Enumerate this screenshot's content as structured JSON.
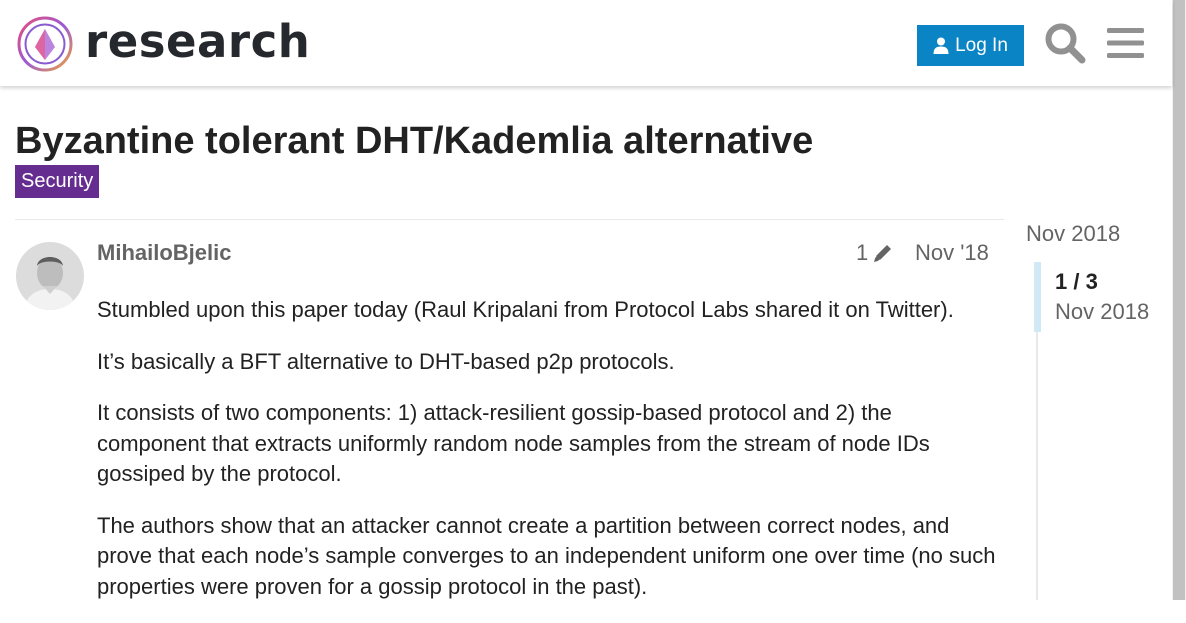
{
  "header": {
    "site_name": "research",
    "login_label": "Log In"
  },
  "topic": {
    "title": "Byzantine tolerant DHT/Kademlia alternative",
    "category": "Security",
    "category_color": "#652d90"
  },
  "post": {
    "username": "MihailoBjelic",
    "edit_count": "1",
    "date": "Nov '18",
    "paragraphs": [
      "Stumbled upon this paper today (Raul Kripalani from Protocol Labs shared it on Twitter).",
      "It’s basically a BFT alternative to DHT-based p2p protocols.",
      "It consists of two components: 1) attack-resilient gossip-based protocol and 2) the component that extracts uniformly random node samples from the stream of node IDs gossiped by the protocol.",
      "The authors show that an attacker cannot create a partition between correct nodes, and prove that each node’s sample converges to an independent uniform one over time (no such properties were proven for a gossip protocol in the past)."
    ]
  },
  "timeline": {
    "start_date": "Nov 2018",
    "position": "1 / 3",
    "current_date": "Nov 2018"
  },
  "icons": {
    "logo": "ethereum-research-logo",
    "login": "user-icon",
    "search": "search-icon",
    "menu": "hamburger-menu-icon",
    "edit": "pencil-icon"
  },
  "colors": {
    "accent": "#0a84c4",
    "text": "#222222",
    "muted": "#646464"
  }
}
